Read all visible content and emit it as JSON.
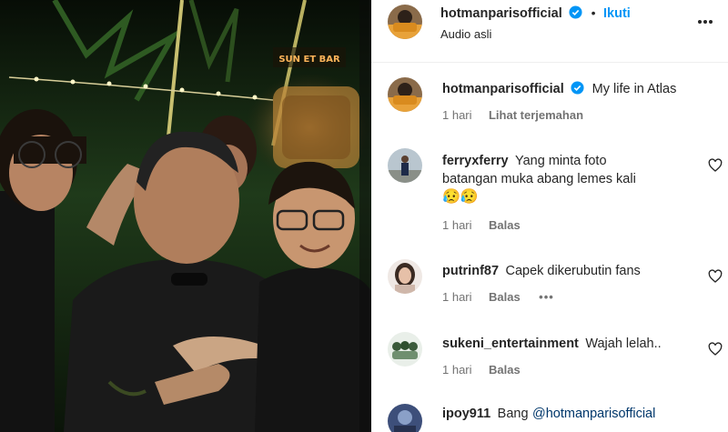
{
  "post": {
    "username": "hotmanparisofficial",
    "verified_icon": "verified-badge-icon",
    "separator": "•",
    "follow_label": "Ikuti",
    "audio_label": "Audio asli",
    "more_icon": "more-options-icon",
    "accent_color": "#0095f6",
    "verified_color": "#0095f6"
  },
  "video_scene": {
    "sign_text": "SUN ET BAR"
  },
  "caption": {
    "username": "hotmanparisofficial",
    "text": "My life in Atlas",
    "time": "1 hari",
    "translate_label": "Lihat terjemahan"
  },
  "comments": [
    {
      "username": "ferryxferry",
      "text_line1": "Yang minta foto",
      "text_line2": "batangan muka abang lemes kali",
      "emoji": "😥😥",
      "time": "1 hari",
      "reply_label": "Balas"
    },
    {
      "username": "putrinf87",
      "text": "Capek dikerubutin fans",
      "time": "1 hari",
      "reply_label": "Balas",
      "more": "•••"
    },
    {
      "username": "sukeni_entertainment",
      "text": "Wajah lelah..",
      "time": "1 hari",
      "reply_label": "Balas"
    },
    {
      "username": "ipoy911",
      "text": "Bang",
      "mention": "@hotmanparisofficial"
    }
  ]
}
